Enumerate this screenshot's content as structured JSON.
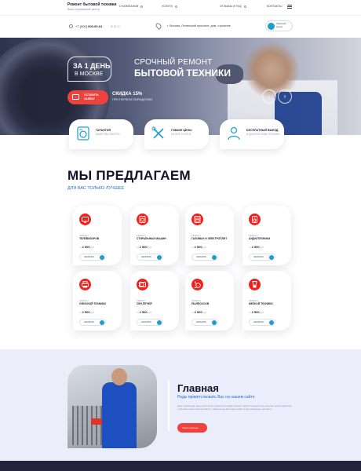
{
  "header": {
    "brand_title": "Ремонт бытовой техники",
    "brand_subtitle": "Ваш сервисный центр",
    "nav": [
      {
        "label": "О КОМПАНИИ"
      },
      {
        "label": "УСЛУГИ"
      },
      {
        "label": "ОТЗЫВЫ И FAQ"
      },
      {
        "label": "КОНТАКТЫ"
      }
    ]
  },
  "contact": {
    "phone_prefix": "+7 (000)",
    "phone_number": "000-00-01",
    "social": "✆ ⓦ ⓥ",
    "address": "г. Москва, Ленинский проспект, дом, строение",
    "callback": "Обратный звонок"
  },
  "hero": {
    "box_line1": "ЗА 1 ДЕНЬ",
    "box_line2": "В МОСКВЕ",
    "title_line1": "СРОЧНЫЙ РЕМОНТ",
    "title_line2": "БЫТОВОЙ ТЕХНИКИ",
    "order_button": "ОСТАВИТЬ ЗАЯВКУ",
    "discount_title": "СКИДКА 15%",
    "discount_note": "ПРИ ПЕРВОМ ОБРАЩЕНИИ",
    "prev_arrow": "‹",
    "next_arrow": "›"
  },
  "features": [
    {
      "title": "ГАРАНТИЯ",
      "subtitle": "КАЧЕСТВА РАБОТЫ"
    },
    {
      "title": "ГИБКИЕ ЦЕНЫ",
      "subtitle": "НА ВСЕ УСЛУГИ"
    },
    {
      "title": "БЕСПЛАТНЫЙ ВЫЕЗД",
      "subtitle": "И ДИАГНОСТИКА ТЕХНИКИ"
    }
  ],
  "offers": {
    "title": "МЫ ПРЕДЛАГАЕМ",
    "subtitle": "ДЛЯ ВАС ТОЛЬКО ЛУЧШЕЕ",
    "cards": [
      {
        "category": "РЕМОНТ",
        "name": "ТЕЛЕВИЗОРОВ",
        "price_prefix": "от",
        "price": "2 500",
        "currency": "руб",
        "button": "ЗАКАЗАТЬ",
        "icon": "tv-icon"
      },
      {
        "category": "РЕМОНТ",
        "name": "СТИРАЛЬНЫХ МАШИН",
        "price_prefix": "от",
        "price": "2 500",
        "currency": "руб",
        "button": "ЗАКАЗАТЬ",
        "icon": "washing-machine-icon"
      },
      {
        "category": "РЕМОНТ",
        "name": "ГАЗОВЫХ И ЭЛЕКТРОПЛИТ",
        "price_prefix": "от",
        "price": "2 500",
        "currency": "руб",
        "button": "ЗАКАЗАТЬ",
        "icon": "stove-icon"
      },
      {
        "category": "РЕМОНТ",
        "name": "АУДИОТЕХНИКИ",
        "price_prefix": "от",
        "price": "2 500",
        "currency": "руб",
        "button": "ЗАКАЗАТЬ",
        "icon": "speaker-icon"
      },
      {
        "category": "РЕМОНТ",
        "name": "ОФИСНОЙ ТЕХНИКИ",
        "price_prefix": "от",
        "price": "2 500",
        "currency": "руб",
        "button": "ЗАКАЗАТЬ",
        "icon": "printer-icon"
      },
      {
        "category": "РЕМОНТ",
        "name": "СВЧ-ПЕЧЕЙ",
        "price_prefix": "от",
        "price": "2 500",
        "currency": "руб",
        "button": "ЗАКАЗАТЬ",
        "icon": "microwave-icon"
      },
      {
        "category": "РЕМОНТ",
        "name": "ПЫЛЕСОСОВ",
        "price_prefix": "от",
        "price": "2 500",
        "currency": "руб",
        "button": "ЗАКАЗАТЬ",
        "icon": "vacuum-icon"
      },
      {
        "category": "РЕМОНТ",
        "name": "МЕЛКОЙ ТЕХНИКИ",
        "price_prefix": "от",
        "price": "2 500",
        "currency": "руб",
        "button": "ЗАКАЗАТЬ",
        "icon": "blender-icon"
      }
    ]
  },
  "about": {
    "title": "Главная",
    "subtitle": "Рады приветствовать Вас на нашем сайте",
    "text": "Наш сервисный центр выполняет ремонт бытовой техники любой сложности в короткие сроки. Мастера с многолетним опытом работы, гарантия на все виды работ и оригинальные запчасти.",
    "button": "Узнать больше"
  },
  "colors": {
    "accent_red": "#f1221e",
    "accent_blue": "#1d6fd1",
    "teal": "#1d9fc9"
  }
}
